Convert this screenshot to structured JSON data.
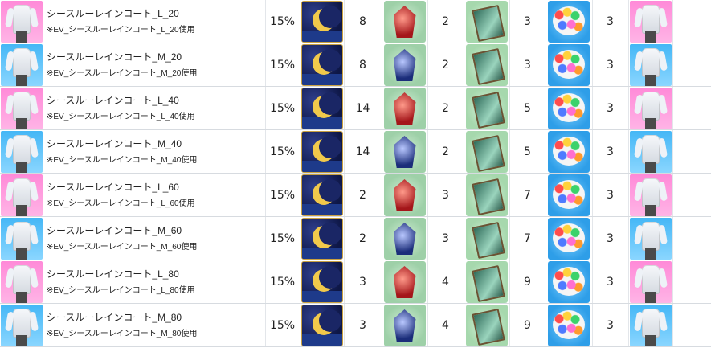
{
  "colors": {
    "pink_bg": "#ff8ad8",
    "blue_bg": "#45b7f6",
    "grid_line": "#d7dbe0"
  },
  "rows": [
    {
      "variant": "pink",
      "name": "シースルーレインコート_L_20",
      "sub": "※EV_シースルーレインコート_L_20使用",
      "percent": "15%",
      "moon_icon": "moon-crescent-icon",
      "moon_qty": "8",
      "gem_color": "red",
      "gem_qty": "2",
      "card_qty": "3",
      "flower_qty": "3"
    },
    {
      "variant": "blue",
      "name": "シースルーレインコート_M_20",
      "sub": "※EV_シースルーレインコート_M_20使用",
      "percent": "15%",
      "moon_icon": "moon-crescent-icon",
      "moon_qty": "8",
      "gem_color": "blue",
      "gem_qty": "2",
      "card_qty": "3",
      "flower_qty": "3"
    },
    {
      "variant": "pink",
      "name": "シースルーレインコート_L_40",
      "sub": "※EV_シースルーレインコート_L_40使用",
      "percent": "15%",
      "moon_icon": "moon-crescent-icon",
      "moon_qty": "14",
      "gem_color": "red",
      "gem_qty": "2",
      "card_qty": "5",
      "flower_qty": "3"
    },
    {
      "variant": "blue",
      "name": "シースルーレインコート_M_40",
      "sub": "※EV_シースルーレインコート_M_40使用",
      "percent": "15%",
      "moon_icon": "moon-crescent-icon",
      "moon_qty": "14",
      "gem_color": "blue",
      "gem_qty": "2",
      "card_qty": "5",
      "flower_qty": "3"
    },
    {
      "variant": "pink",
      "name": "シースルーレインコート_L_60",
      "sub": "※EV_シースルーレインコート_L_60使用",
      "percent": "15%",
      "moon_icon": "moon-crescent-icon",
      "moon_qty": "2",
      "gem_color": "red",
      "gem_qty": "3",
      "card_qty": "7",
      "flower_qty": "3"
    },
    {
      "variant": "blue",
      "name": "シースルーレインコート_M_60",
      "sub": "※EV_シースルーレインコート_M_60使用",
      "percent": "15%",
      "moon_icon": "moon-crescent-icon",
      "moon_qty": "2",
      "gem_color": "blue",
      "gem_qty": "3",
      "card_qty": "7",
      "flower_qty": "3"
    },
    {
      "variant": "pink",
      "name": "シースルーレインコート_L_80",
      "sub": "※EV_シースルーレインコート_L_80使用",
      "percent": "15%",
      "moon_icon": "moon-crescent-icon",
      "moon_qty": "3",
      "gem_color": "red",
      "gem_qty": "4",
      "card_qty": "9",
      "flower_qty": "3"
    },
    {
      "variant": "blue",
      "name": "シースルーレインコート_M_80",
      "sub": "※EV_シースルーレインコート_M_80使用",
      "percent": "15%",
      "moon_icon": "moon-crescent-icon",
      "moon_qty": "3",
      "gem_color": "blue",
      "gem_qty": "4",
      "card_qty": "9",
      "flower_qty": "3"
    }
  ]
}
